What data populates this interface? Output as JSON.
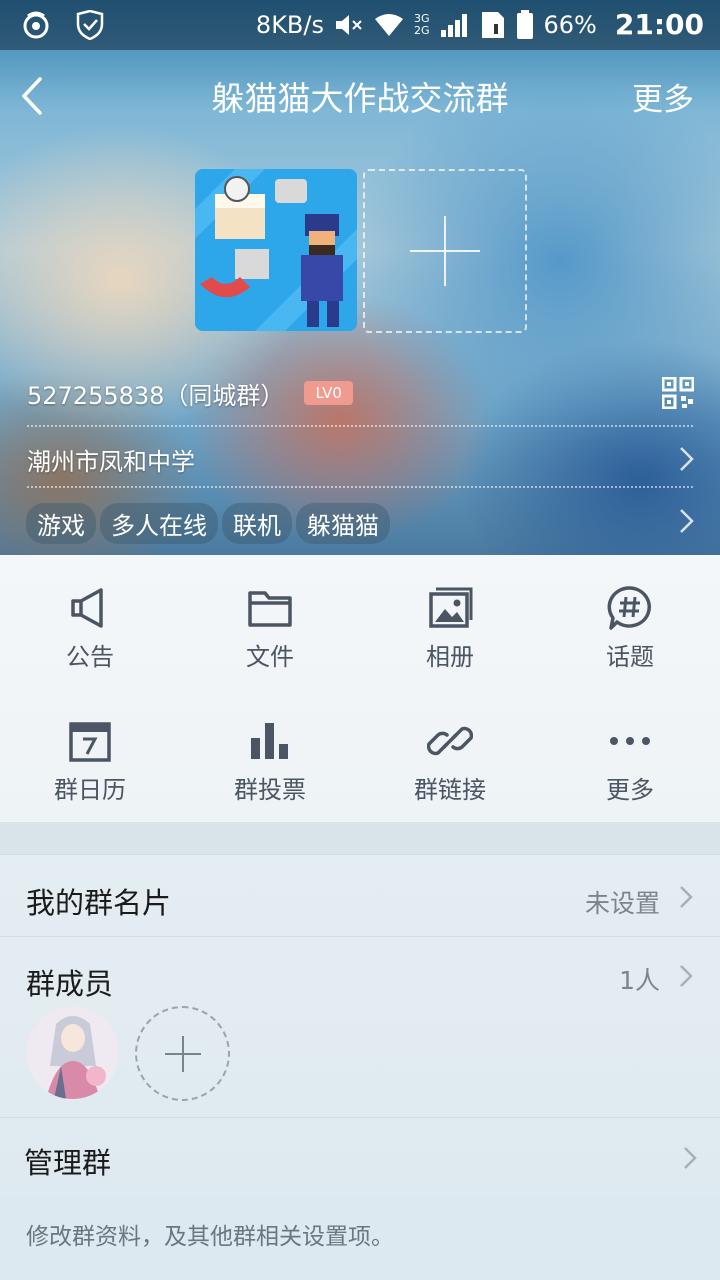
{
  "status_bar": {
    "speed": "8KB/s",
    "network_top": "3G",
    "network_bottom": "2G",
    "battery": "66%",
    "time": "21:00"
  },
  "nav": {
    "title": "躲猫猫大作战交流群",
    "more": "更多"
  },
  "group": {
    "id_text": "527255838（同城群）",
    "level": "LV0",
    "location": "潮州市凤和中学",
    "tags": [
      "游戏",
      "多人在线",
      "联机",
      "躲猫猫"
    ]
  },
  "features": [
    {
      "label": "公告",
      "icon": "megaphone-icon"
    },
    {
      "label": "文件",
      "icon": "folder-icon"
    },
    {
      "label": "相册",
      "icon": "album-icon"
    },
    {
      "label": "话题",
      "icon": "topic-icon"
    },
    {
      "label": "群日历",
      "icon": "calendar-icon"
    },
    {
      "label": "群投票",
      "icon": "bar-chart-icon"
    },
    {
      "label": "群链接",
      "icon": "link-icon"
    },
    {
      "label": "更多",
      "icon": "more-dots-icon"
    }
  ],
  "rows": {
    "card_label": "我的群名片",
    "card_value": "未设置",
    "members_label": "群成员",
    "members_value": "1人",
    "manage_label": "管理群"
  },
  "footer": {
    "hint": "修改群资料，及其他群相关设置项。"
  },
  "colors": {
    "level_badge": "#f19a8f",
    "icon": "#4b5563"
  }
}
